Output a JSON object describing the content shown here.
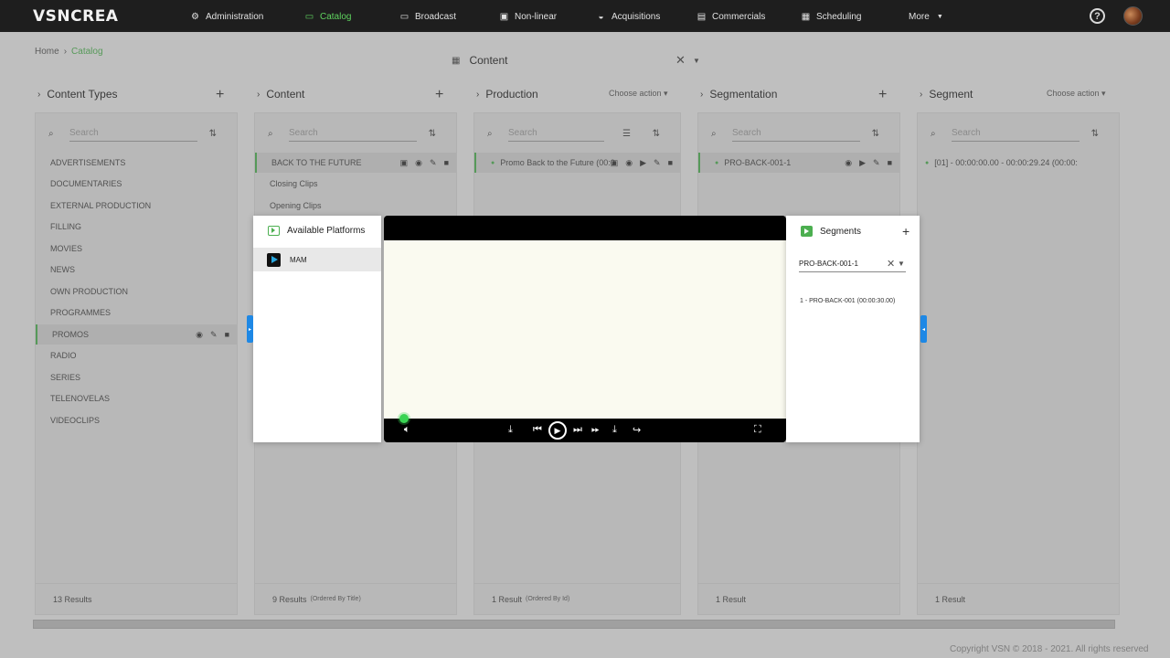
{
  "brand": {
    "logo_text": "VSNCREA"
  },
  "nav": [
    {
      "label": "Administration",
      "icon": "gear-icon"
    },
    {
      "label": "Catalog",
      "icon": "tv-icon",
      "active": true
    },
    {
      "label": "Broadcast",
      "icon": "cast-icon"
    },
    {
      "label": "Non-linear",
      "icon": "play-square-icon"
    },
    {
      "label": "Acquisitions",
      "icon": "basket-icon"
    },
    {
      "label": "Commercials",
      "icon": "document-icon"
    },
    {
      "label": "Scheduling",
      "icon": "calendar-icon"
    },
    {
      "label": "More",
      "icon": "caret-down-icon"
    }
  ],
  "breadcrumb": {
    "home": "Home",
    "current": "Catalog"
  },
  "content_selector": {
    "value": "Content"
  },
  "columns": [
    {
      "title": "Content Types",
      "search_placeholder": "Search",
      "footer": "13 Results",
      "footer_note": "",
      "items": [
        "ADVERTISEMENTS",
        "DOCUMENTARIES",
        "EXTERNAL PRODUCTION",
        "FILLING",
        "MOVIES",
        "NEWS",
        "OWN PRODUCTION",
        "PROGRAMMES",
        "PROMOS",
        "RADIO",
        "SERIES",
        "TELENOVELAS",
        "VIDEOCLIPS"
      ],
      "selected_index": 8
    },
    {
      "title": "Content",
      "search_placeholder": "Search",
      "footer": "9 Results",
      "footer_note": "(Ordered By Title)",
      "items": [
        "BACK TO THE FUTURE",
        "Closing Clips",
        "Opening Clips"
      ],
      "selected_index": 0
    },
    {
      "title": "Production",
      "choose_action": "Choose action",
      "search_placeholder": "Search",
      "footer": "1 Result",
      "footer_note": "(Ordered By Id)",
      "items": [
        "Promo Back to the Future (00:0"
      ],
      "selected_index": 0
    },
    {
      "title": "Segmentation",
      "search_placeholder": "Search",
      "footer": "1 Result",
      "footer_note": "",
      "items": [
        "PRO-BACK-001-1"
      ],
      "selected_index": 0
    },
    {
      "title": "Segment",
      "choose_action": "Choose action",
      "search_placeholder": "Search",
      "footer": "1 Result",
      "footer_note": "",
      "items": [
        "[01] - 00:00:00.00 - 00:00:29.24 (00:00:"
      ],
      "selected_index": -1
    }
  ],
  "modal": {
    "platforms_title": "Available Platforms",
    "platform_item": "MAM",
    "segments_title": "Segments",
    "segment_select": "PRO-BACK-001-1",
    "segment_item": "1 - PRO-BACK-001 (00:00:30.00)"
  },
  "footer": {
    "copyright": "Copyright VSN © 2018 - 2021. All rights reserved"
  }
}
